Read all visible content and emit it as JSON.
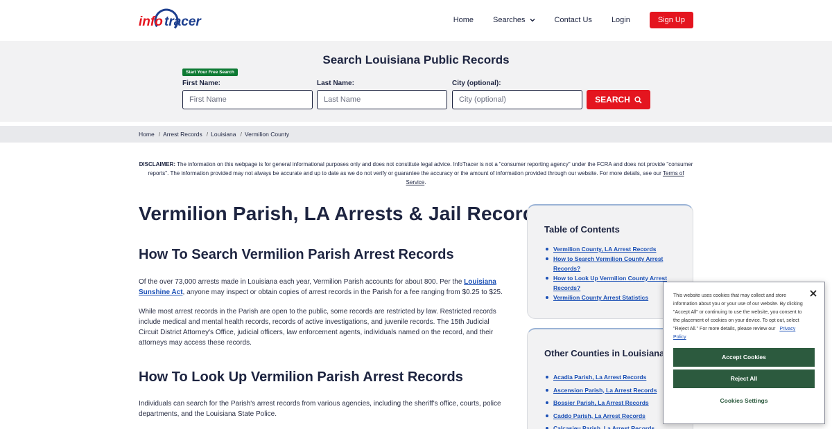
{
  "header": {
    "logo_text": "infotracer",
    "nav": {
      "home": "Home",
      "searches": "Searches",
      "contact": "Contact Us",
      "login": "Login",
      "signup": "Sign Up"
    }
  },
  "search": {
    "title": "Search Louisiana Public Records",
    "badge": "Start Your Free Search",
    "first_label": "First Name:",
    "first_placeholder": "First Name",
    "last_label": "Last Name:",
    "last_placeholder": "Last Name",
    "city_label": "City (optional):",
    "city_placeholder": "City (optional)",
    "button": "SEARCH"
  },
  "breadcrumb": [
    "Home",
    "Arrest Records",
    "Louisiana",
    "Vermilion County"
  ],
  "disclaimer": {
    "label": "DISCLAIMER:",
    "text": "The information on this webpage is for general informational purposes only and does not constitute legal advice. InfoTracer is not a \"consumer reporting agency\" under the FCRA and does not provide \"consumer reports\". The information provided may not always be accurate and up to date as we do not verify or guarantee the accuracy or the amount of information provided through our website. For more details, see our",
    "tos": "Terms of Service",
    "end": "."
  },
  "main": {
    "h1": "Vermilion Parish, LA Arrests & Jail Records",
    "h2_search": "How To Search Vermilion Parish Arrest Records",
    "p1_a": "Of the over 73,000 arrests made in Louisiana each year, Vermilion Parish accounts for about 800. Per the",
    "p1_link": "Louisiana Sunshine Act",
    "p1_b": ", anyone may inspect or obtain copies of arrest records in the Parish for a fee ranging from $0.25 to $25.",
    "p2": "While most arrest records in the Parish are open to the public, some records are restricted by law. Restricted records include medical and mental health records, records of active investigations, and juvenile records. The 15th Judicial Circuit District Attorney's Office, judicial officers, law enforcement agents, individuals named on the record, and their attorneys may access these records.",
    "h2_lookup": "How To Look Up Vermilion Parish Arrest Records",
    "p3": "Individuals can search for the Parish's arrest records from various agencies, including the sheriff's office, courts, police departments, and the Louisiana State Police."
  },
  "toc": {
    "title": "Table of Contents",
    "items": [
      "Vermilion County, LA Arrest Records",
      "How to Search Vermilion County Arrest Records?",
      "How to Look Up Vermilion County Arrest Records?",
      "Vermilion County Arrest Statistics"
    ]
  },
  "counties": {
    "title": "Other Counties in Louisiana",
    "items": [
      "Acadia Parish, La Arrest Records",
      "Ascension Parish, La Arrest Records",
      "Bossier Parish, La Arrest Records",
      "Caddo Parish, La Arrest Records",
      "Calcasieu Parish, La Arrest Records"
    ]
  },
  "cookie": {
    "text": "This website uses cookies that may collect and store information about you or your use of our website. By clicking \"Accept All\" or continuing to use the website, you consent to the placement of cookies on your device. To opt out, select \"Reject All.\" For more details, please review our",
    "privacy": "Privacy Policy",
    "accept": "Accept Cookies",
    "reject": "Reject All",
    "settings": "Cookies Settings"
  },
  "colors": {
    "brand_red": "#e4151f",
    "brand_navy": "#1d2440",
    "link_blue": "#1a4fb5",
    "cookie_green": "#2c5a3e",
    "badge_green": "#0d7a33"
  }
}
